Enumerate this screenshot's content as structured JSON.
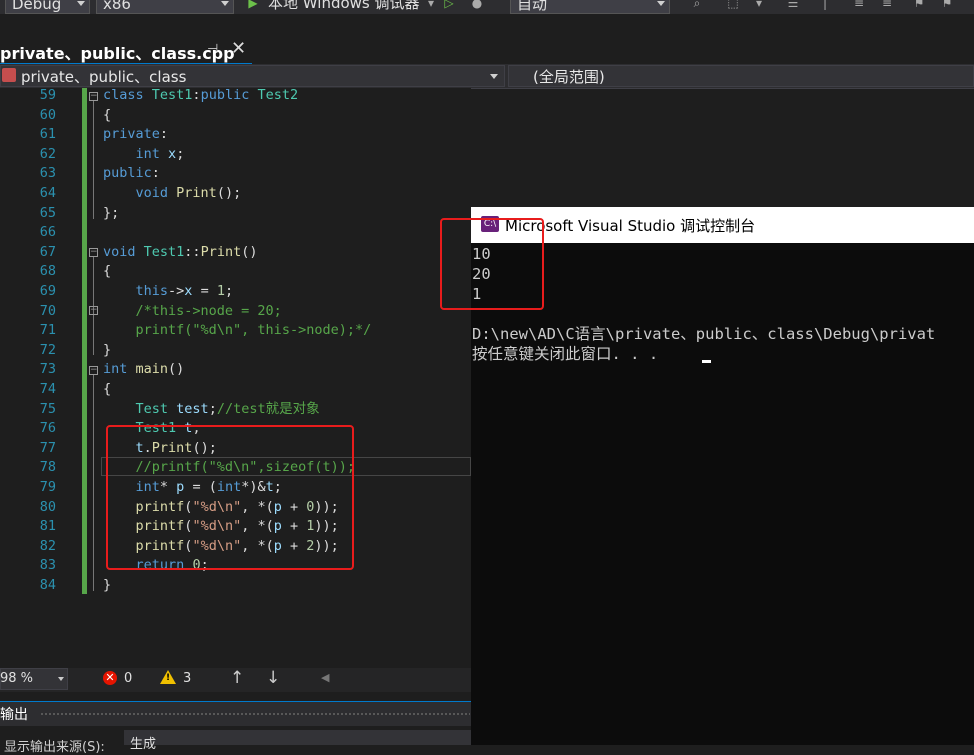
{
  "toolbar": {
    "config": "Debug",
    "platform": "x86",
    "run_label": "本地 Windows 调试器",
    "auto_label": "自动"
  },
  "tab": {
    "title": "private、public、class.cpp"
  },
  "nav": {
    "file": "private、public、class",
    "scope": "(全局范围)"
  },
  "editor": {
    "line_numbers": [
      "59",
      "60",
      "61",
      "62",
      "63",
      "64",
      "65",
      "66",
      "67",
      "68",
      "69",
      "70",
      "71",
      "72",
      "73",
      "74",
      "75",
      "76",
      "77",
      "78",
      "79",
      "80",
      "81",
      "82",
      "83",
      "84"
    ]
  },
  "status": {
    "zoom": "98 %",
    "errors": "0",
    "warnings": "3"
  },
  "output": {
    "title": "输出",
    "source_label": "显示输出来源(S):",
    "source_value": "生成"
  },
  "console": {
    "title": "Microsoft Visual Studio 调试控制台",
    "lines": [
      "10",
      "20",
      "1",
      "",
      "D:\\new\\AD\\C语言\\private、public、class\\Debug\\privat",
      "按任意键关闭此窗口. . ."
    ]
  },
  "colors": {
    "accent": "#007acc",
    "annotation": "#e81c1c",
    "editor_bg": "#1e1e1e",
    "console_bg": "#0c0c0c"
  }
}
